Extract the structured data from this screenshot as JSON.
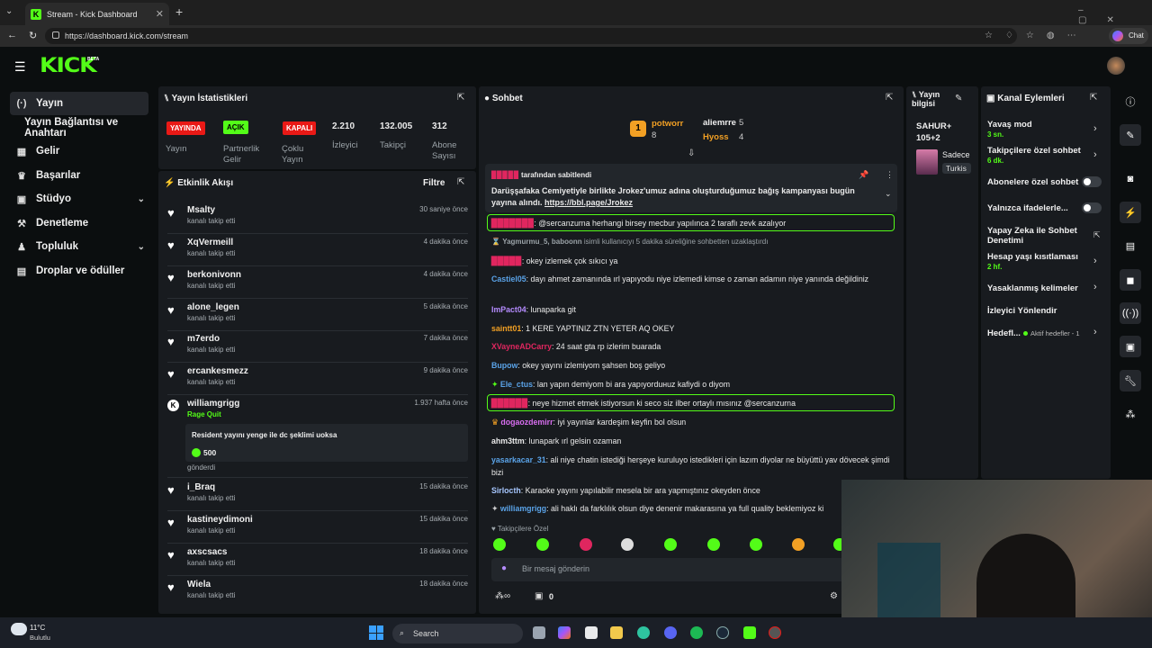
{
  "browser": {
    "tab_title": "Stream - Kick Dashboard",
    "url": "https://dashboard.kick.com/stream",
    "chat_button": "Chat"
  },
  "header": {
    "logo": "KICK",
    "logo_badge": "BETA"
  },
  "sidebar": {
    "items": [
      {
        "label": "Yayın",
        "icon": "broadcast-icon"
      },
      {
        "label": "Yayın Bağlantısı ve Anahtarı"
      },
      {
        "label": "Gelir",
        "icon": "revenue-icon"
      },
      {
        "label": "Başarılar",
        "icon": "trophy-icon"
      },
      {
        "label": "Stüdyo",
        "icon": "studio-icon"
      },
      {
        "label": "Denetleme",
        "icon": "hammer-icon"
      },
      {
        "label": "Topluluk",
        "icon": "community-icon"
      },
      {
        "label": "Droplar ve ödüller",
        "icon": "drops-icon"
      }
    ]
  },
  "stats": {
    "title": "Yayın İstatistikleri",
    "badges": [
      {
        "badge": "YAYINDA",
        "label": "Yayın",
        "color": "#e91916"
      },
      {
        "badge": "AÇIK",
        "label": "Partnerlik Gelir",
        "color": "#53fc18"
      },
      {
        "badge": "KAPALI",
        "label": "Çoklu Yayın",
        "color": "#e91916"
      }
    ],
    "numbers": [
      {
        "value": "2.210",
        "label": "İzleyici"
      },
      {
        "value": "132.005",
        "label": "Takipçi"
      },
      {
        "value": "312",
        "label": "Abone Sayısı"
      }
    ]
  },
  "activity": {
    "title": "Etkinlik Akışı",
    "filter": "Filtre",
    "rows": [
      {
        "name": "Msalty",
        "sub": "kanalı takip etti",
        "time": "30 saniye önce"
      },
      {
        "name": "XqVermeill",
        "sub": "kanalı takip etti",
        "time": "4 dakika önce"
      },
      {
        "name": "berkonivonn",
        "sub": "kanalı takip etti",
        "time": "4 dakika önce"
      },
      {
        "name": "alone_legen",
        "sub": "kanalı takip etti",
        "time": "5 dakika önce"
      },
      {
        "name": "m7erdo",
        "sub": "kanalı takip etti",
        "time": "7 dakika önce"
      },
      {
        "name": "ercankesmezz",
        "sub": "kanalı takip etti",
        "time": "9 dakika önce"
      }
    ],
    "special": {
      "name": "williamgrigg",
      "tag": "Rage Quit",
      "time": "1.937 hafta önce",
      "message": "Resident yayını yenge ile dc şeklimi uoksa",
      "amount": "500",
      "sent": "gönderdi"
    },
    "rows2": [
      {
        "name": "i_Braq",
        "sub": "kanalı takip etti",
        "time": "15 dakika önce"
      },
      {
        "name": "kastineydimoni",
        "sub": "kanalı takip etti",
        "time": "15 dakika önce"
      },
      {
        "name": "axscsacs",
        "sub": "kanalı takip etti",
        "time": "18 dakika önce"
      },
      {
        "name": "Wiela",
        "sub": "kanalı takip etti",
        "time": "18 dakika önce"
      }
    ]
  },
  "chat": {
    "title": "Sohbet",
    "leader": {
      "rank": "1",
      "name": "potworr",
      "count": "8"
    },
    "leader2": {
      "name": "aliemrre",
      "count": "5"
    },
    "leader3": {
      "name": "Hyoss",
      "count": "4"
    },
    "pinned_by": "tarafından sabitlendi",
    "pinned_text": "Darüşşafaka Cemiyetiyle birlikte Jrokez'umuz adına oluşturduğumuz bağış kampanyası bugün yayına alındı.",
    "pinned_link": "https://bbl.page/Jrokez",
    "messages": [
      {
        "user": "",
        "text": ": @sercanzurna herhangi birsey mecbur yapılınca 2 taraflı zevk azalıyor",
        "color": "#e0265f",
        "hl": true
      },
      {
        "user": "Yagmurmu_5, baboonn",
        "text": " isimli kullanıcıyı 5 dakika süreliğine sohbetten uzaklaştırdı",
        "color": "#9ba3a8",
        "sys": true
      },
      {
        "user": "",
        "text": ": okey izlemek çok sıkıcı ya",
        "color": "#e0265f"
      },
      {
        "user": "Castiel05",
        "text": ": dayı ahmet zamanında ırl yapıyodu niye izlemedi kimse o zaman adamın niye yanında değildiniz",
        "color": "#5aa3e8"
      },
      {
        "user": "ImPact04",
        "text": ": lunaparka git",
        "color": "#b58cff"
      },
      {
        "user": "saintt01",
        "text": ": 1 KERE YAPTINIZ ZTN YETER AQ OKEY",
        "color": "#f2a024"
      },
      {
        "user": "XVayneADCarry",
        "text": ": 24 saat gta rp izlerim buarada",
        "color": "#e0265f"
      },
      {
        "user": "Bupow",
        "text": ": okey yayını izlemiyom şahsen boş geliyo",
        "color": "#5aa3e8"
      },
      {
        "user": "Ele_ctus",
        "text": ": lan yapın demiyom bi ara yapıyorduнuz kafiydi o diyom",
        "color": "#5aa3e8"
      },
      {
        "user": "",
        "text": ": neye hizmet etmek istiyorsun ki seco siz ilber ortaylı mısınız @sercanzurna",
        "color": "#e0265f",
        "hl": true
      },
      {
        "user": "dogaozdemirr",
        "text": ": iyi yayınlar kardeşim keyfin bol olsun",
        "color": "#d86ef0"
      },
      {
        "user": "ahm3ttm",
        "text": ": lunapark ırl gelsin ozaman",
        "color": "#eaeaea"
      },
      {
        "user": "yasarkacar_31",
        "text": ": ali niye chatin istediği herşeye kuruluyo istedikleri için lazım diyolar ne büyüttü yav dövecek şimdi bizi",
        "color": "#5aa3e8"
      },
      {
        "user": "Sirlocth",
        "text": ": Karaoke yayını yapılabilir mesela bir ara yapmıştınız okeyden önce",
        "color": "#a7c7ff"
      },
      {
        "user": "williamgrigg",
        "text": ": ali haklı da farklılık olsun diye denenir makarasına ya full quality beklemiyoz ki",
        "color": "#5aa3e8"
      }
    ],
    "followers_only": "Takipçilere Özel",
    "input_placeholder": "Bir mesaj gönderin",
    "bottom_count": "0"
  },
  "stream_info": {
    "title": "Yayın bilgisi",
    "item1": "SAHUR+",
    "item2": "105+2",
    "item3": "Sadece",
    "tag": "Turkis"
  },
  "channel_actions": {
    "title": "Kanal Eylemleri",
    "items": [
      {
        "label": "Yavaş mod",
        "sub": "3 sn."
      },
      {
        "label": "Takipçilere özel sohbet",
        "sub": "6 dk."
      },
      {
        "label": "Abonelere özel sohbet"
      },
      {
        "label": "Yalnızca ifadelerle..."
      },
      {
        "label": "Yapay Zeka ile Sohbet Denetimi"
      },
      {
        "label": "Hesap yaşı kısıtlaması",
        "sub": "2 hf."
      },
      {
        "label": "Yasaklanmış kelimeler"
      },
      {
        "label": "İzleyici Yönlendir"
      },
      {
        "label": "Hedefl...",
        "sub": "Aktif hedefler - 1"
      }
    ]
  },
  "taskbar": {
    "weather_temp": "11°C",
    "weather_desc": "Bulutlu",
    "search": "Search"
  }
}
